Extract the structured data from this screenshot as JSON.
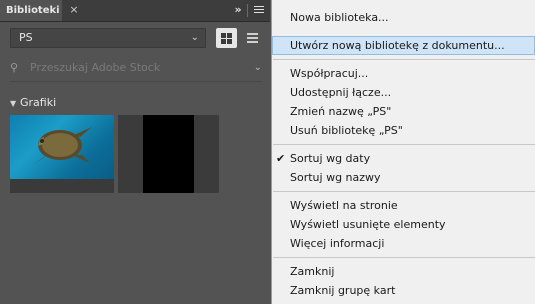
{
  "panel": {
    "tab_label": "Biblioteki",
    "tab_close": "×",
    "collapse_glyph": "»",
    "library_select_value": "PS",
    "search_placeholder": "Przeszukaj Adobe Stock",
    "section_title": "Grafiki"
  },
  "menu": {
    "items": [
      {
        "label": "Nowa biblioteka..."
      },
      {
        "label": "Utwórz nową bibliotekę z dokumentu...",
        "highlighted": true
      },
      {
        "label": "Współpracuj..."
      },
      {
        "label": "Udostępnij łącze..."
      },
      {
        "label": "Zmień nazwę „PS\""
      },
      {
        "label": "Usuń bibliotekę „PS\""
      },
      {
        "label": "Sortuj wg daty",
        "checked": true
      },
      {
        "label": "Sortuj wg nazwy"
      },
      {
        "label": "Wyświetl na stronie"
      },
      {
        "label": "Wyświetl usunięte elementy"
      },
      {
        "label": "Więcej informacji"
      },
      {
        "label": "Zamknij"
      },
      {
        "label": "Zamknij grupę kart"
      }
    ],
    "check_glyph": "✔"
  },
  "colors": {
    "panel_bg": "#535353",
    "menu_bg": "#f0f0f0",
    "highlight_bg": "#cfe4f7",
    "highlight_border": "#8fbde6"
  }
}
